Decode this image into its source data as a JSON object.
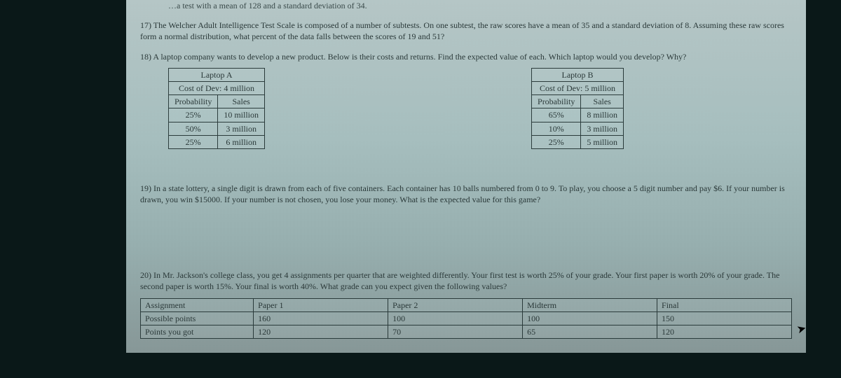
{
  "partial_top": "…a test with a mean of 128 and a standard deviation of 34.",
  "q17": "17) The Welcher Adult Intelligence Test Scale is composed of a number of subtests. On one subtest, the raw scores have a mean of 35 and a standard deviation of 8. Assuming these raw scores form a normal distribution, what percent of the data falls between the scores of 19 and 51?",
  "q18": "18) A laptop company wants to develop a new product. Below is their costs and returns. Find the expected value of each. Which laptop would you develop? Why?",
  "laptopA": {
    "title": "Laptop A",
    "cost": "Cost of Dev: 4 million",
    "h1": "Probability",
    "h2": "Sales",
    "r1c1": "25%",
    "r1c2": "10 million",
    "r2c1": "50%",
    "r2c2": "3 million",
    "r3c1": "25%",
    "r3c2": "6 million"
  },
  "laptopB": {
    "title": "Laptop B",
    "cost": "Cost of Dev: 5 million",
    "h1": "Probability",
    "h2": "Sales",
    "r1c1": "65%",
    "r1c2": "8 million",
    "r2c1": "10%",
    "r2c2": "3 million",
    "r3c1": "25%",
    "r3c2": "5 million"
  },
  "q19": "19) In a state lottery, a single digit is drawn from each of five containers. Each container has 10 balls numbered from 0 to 9. To play, you choose a 5 digit number and pay $6. If your number is drawn, you win $15000. If your number is not chosen, you lose your money. What is the expected value for this game?",
  "q20": "20) In Mr. Jackson's college class, you get 4 assignments per quarter that are weighted differently. Your first test is worth 25% of your grade. Your first paper is worth 20% of your grade. The second paper is worth 15%. Your final is worth 40%. What grade can you expect given the following values?",
  "grades": {
    "h0": "Assignment",
    "h1": "Paper 1",
    "h2": "Paper 2",
    "h3": "Midterm",
    "h4": "Final",
    "r1h": "Possible points",
    "r1c1": "160",
    "r1c2": "100",
    "r1c3": "100",
    "r1c4": "150",
    "r2h": "Points you got",
    "r2c1": "120",
    "r2c2": "70",
    "r2c3": "65",
    "r2c4": "120"
  },
  "chart_data": [
    {
      "type": "table",
      "title": "Laptop A — Cost of Dev: 4 million",
      "columns": [
        "Probability",
        "Sales"
      ],
      "rows": [
        [
          "25%",
          "10 million"
        ],
        [
          "50%",
          "3 million"
        ],
        [
          "25%",
          "6 million"
        ]
      ]
    },
    {
      "type": "table",
      "title": "Laptop B — Cost of Dev: 5 million",
      "columns": [
        "Probability",
        "Sales"
      ],
      "rows": [
        [
          "65%",
          "8 million"
        ],
        [
          "10%",
          "3 million"
        ],
        [
          "25%",
          "5 million"
        ]
      ]
    },
    {
      "type": "table",
      "title": "Assignment grades",
      "columns": [
        "Assignment",
        "Paper 1",
        "Paper 2",
        "Midterm",
        "Final"
      ],
      "rows": [
        [
          "Possible points",
          160,
          100,
          100,
          150
        ],
        [
          "Points you got",
          120,
          70,
          65,
          120
        ]
      ]
    }
  ]
}
